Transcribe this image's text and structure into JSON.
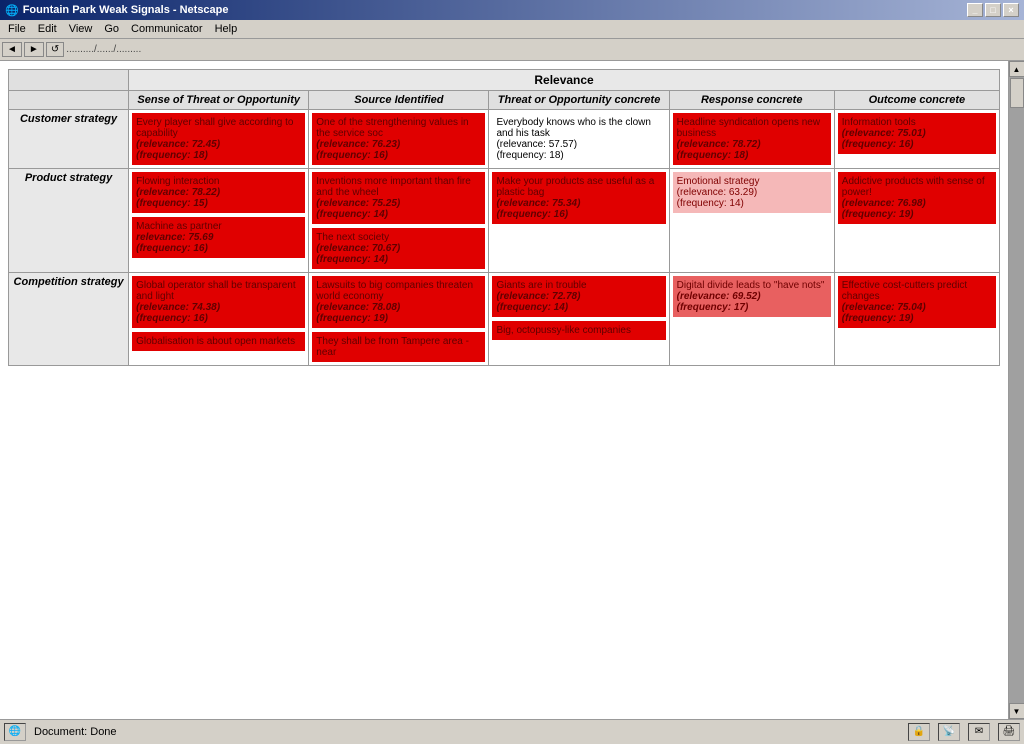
{
  "window": {
    "title": "Fountain Park Weak Signals - Netscape",
    "icon": "🌐"
  },
  "menubar": {
    "items": [
      "File",
      "Edit",
      "View",
      "Go",
      "Communicator",
      "Help"
    ]
  },
  "statusbar": {
    "text": "Document: Done"
  },
  "table": {
    "title": "Relevance",
    "col_headers": [
      "Sense of Threat or Opportunity",
      "Source Identified",
      "Threat or Opportunity concrete",
      "Response concrete",
      "Outcome concrete"
    ],
    "rows": [
      {
        "label": "Customer strategy",
        "cells": [
          {
            "text": "Every player shall give according to capability",
            "relevance": "72.45",
            "frequency": "18",
            "color": "dark"
          },
          {
            "text": "One of the strengthening values in the service soc",
            "relevance": "76.23",
            "frequency": "16",
            "color": "dark"
          },
          {
            "text": "Everybody knows who is the clown and his task",
            "relevance": "57.57",
            "frequency": "18",
            "color": "white"
          },
          {
            "text": "Headline syndication opens new business",
            "relevance": "78.72",
            "frequency": "18",
            "color": "dark"
          },
          {
            "text": "Information tools",
            "relevance": "75.01",
            "frequency": "16",
            "color": "dark"
          }
        ]
      },
      {
        "label": "Product strategy",
        "cells_top": [
          {
            "text": "Flowing interaction",
            "relevance": "78.22",
            "frequency": "15",
            "color": "dark"
          },
          {
            "text": "Inventions more important than fire and the wheel",
            "relevance": "75.25",
            "frequency": "14",
            "color": "dark"
          },
          {
            "text": "Make your products ase useful as a plastic bag",
            "relevance": "75.34",
            "frequency": "16",
            "color": "dark"
          },
          {
            "text": "Emotional strategy",
            "relevance": "63.29",
            "frequency": "14",
            "color": "light"
          },
          {
            "text": "Addictive products with sense of power!",
            "relevance": "76.98",
            "frequency": "19",
            "color": "dark"
          }
        ],
        "cells_bottom": [
          {
            "text": "Machine as partner",
            "relevance": "75.69",
            "frequency": "16",
            "color": "dark"
          },
          {
            "text": "The next society",
            "relevance": "70.67",
            "frequency": "14",
            "color": "dark"
          },
          null,
          null,
          null
        ]
      },
      {
        "label": "Competition strategy",
        "cells_top": [
          {
            "text": "Global operator shall be transparent and light",
            "relevance": "74.38",
            "frequency": "16",
            "color": "dark"
          },
          {
            "text": "Lawsuits to big companies threaten world economy",
            "relevance": "78.08",
            "frequency": "19",
            "color": "dark"
          },
          {
            "text": "Giants are in trouble",
            "relevance": "72.78",
            "frequency": "14",
            "color": "dark"
          },
          {
            "text": "Digital divide leads to \"have nots\"",
            "relevance": "69.52",
            "frequency": "17",
            "color": "medium"
          },
          {
            "text": "Effective cost-cutters predict changes",
            "relevance": "75.04",
            "frequency": "19",
            "color": "dark"
          }
        ],
        "cells_bottom": [
          {
            "text": "Globalisation is about open markets",
            "relevance": "",
            "frequency": "",
            "color": "dark"
          },
          {
            "text": "They shall be from Tampere area - near",
            "relevance": "",
            "frequency": "",
            "color": "dark"
          },
          {
            "text": "Big, octopussy-like companies",
            "relevance": "",
            "frequency": "",
            "color": "dark"
          },
          null,
          null
        ]
      }
    ]
  }
}
